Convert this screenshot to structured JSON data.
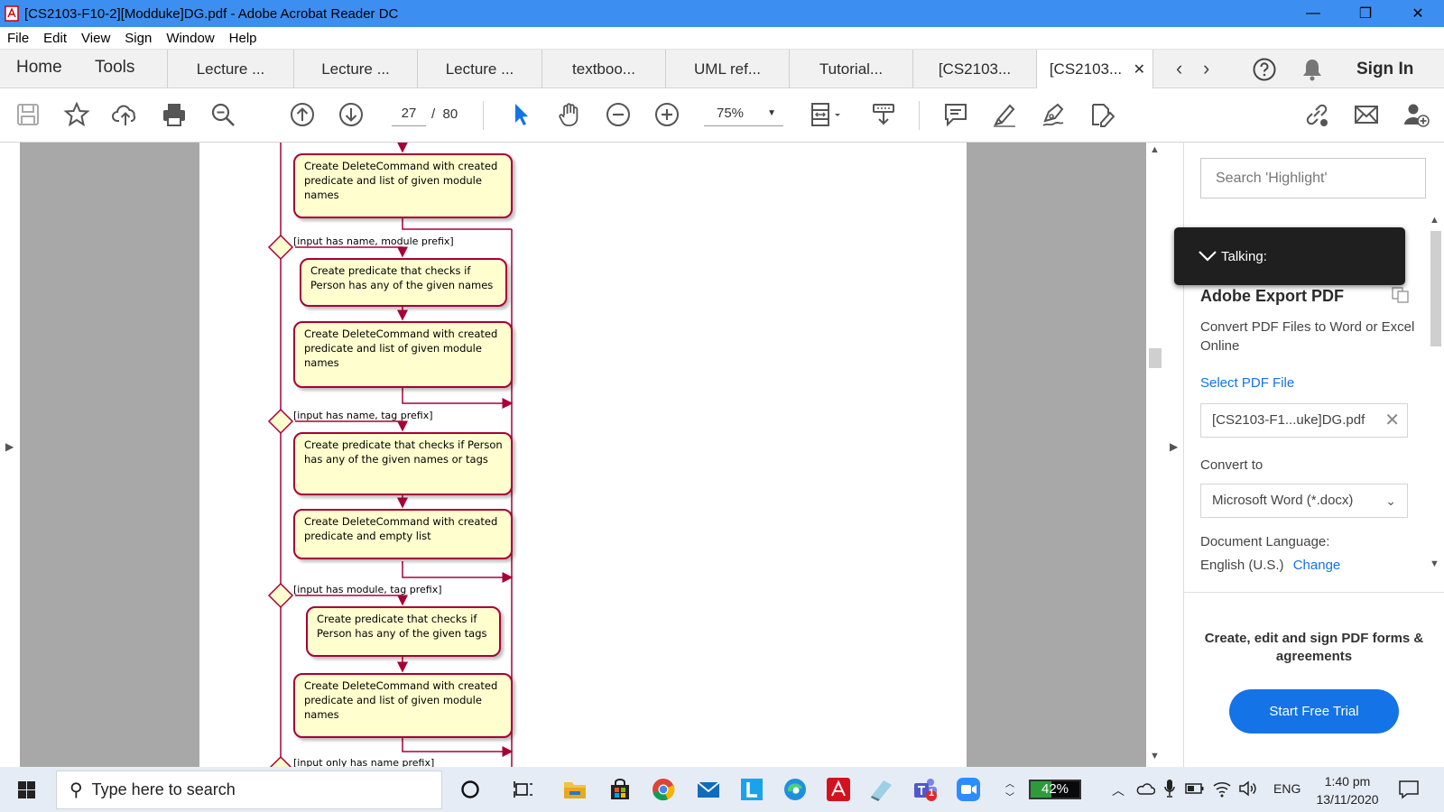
{
  "window": {
    "title": "[CS2103-F10-2][Modduke]DG.pdf - Adobe Acrobat Reader DC",
    "minimize": "—",
    "maximize": "❐",
    "close": "✕"
  },
  "menu": [
    "File",
    "Edit",
    "View",
    "Sign",
    "Window",
    "Help"
  ],
  "tabs": {
    "home": "Home",
    "tools": "Tools",
    "documents": [
      "Lecture ...",
      "Lecture ...",
      "Lecture ...",
      "textboo...",
      "UML ref...",
      "Tutorial...",
      "[CS2103...",
      "[CS2103..."
    ],
    "active_index": 7,
    "close": "✕",
    "back": "‹",
    "forward": "›",
    "sign_in": "Sign In"
  },
  "toolbar": {
    "page_current": "27",
    "page_total": "80",
    "page_sep": "/",
    "zoom": "75%",
    "accent": "#1473e6"
  },
  "diagram": {
    "nodes": [
      "Create DeleteCommand with created predicate and list of given module names",
      "Create predicate that checks if Person has any of the given names",
      "Create DeleteCommand with created predicate and list of given module names",
      "Create predicate that checks if Person has any of the given names or tags",
      "Create DeleteCommand with created predicate and empty list",
      "Create predicate that checks if Person has any of the given tags",
      "Create DeleteCommand with created predicate and list of given module names"
    ],
    "guards": [
      "[input has name, module prefix]",
      "[input has name, tag prefix]",
      "[input has module, tag prefix]",
      "[input only has name prefix]"
    ],
    "line_color": "#a80036",
    "fill_color": "#fefece"
  },
  "panel": {
    "search_placeholder": "Search 'Highlight'",
    "talking": "Talking:",
    "title": "Adobe Export PDF",
    "description": "Convert PDF Files to Word or Excel Online",
    "select_file": "Select PDF File",
    "file_name": "[CS2103-F1...uke]DG.pdf",
    "convert_to_label": "Convert to",
    "convert_to_value": "Microsoft Word (*.docx)",
    "language_label": "Document Language:",
    "language_value": "English (U.S.)",
    "change": "Change",
    "promo": "Create, edit and sign PDF forms & agreements",
    "trial_button": "Start Free Trial"
  },
  "taskbar": {
    "search_placeholder": "Type here to search",
    "battery": "42%",
    "battery_fraction": 0.42,
    "lang": "ENG",
    "time": "1:40 pm",
    "date": "13/11/2020",
    "teams_badge": "1"
  }
}
